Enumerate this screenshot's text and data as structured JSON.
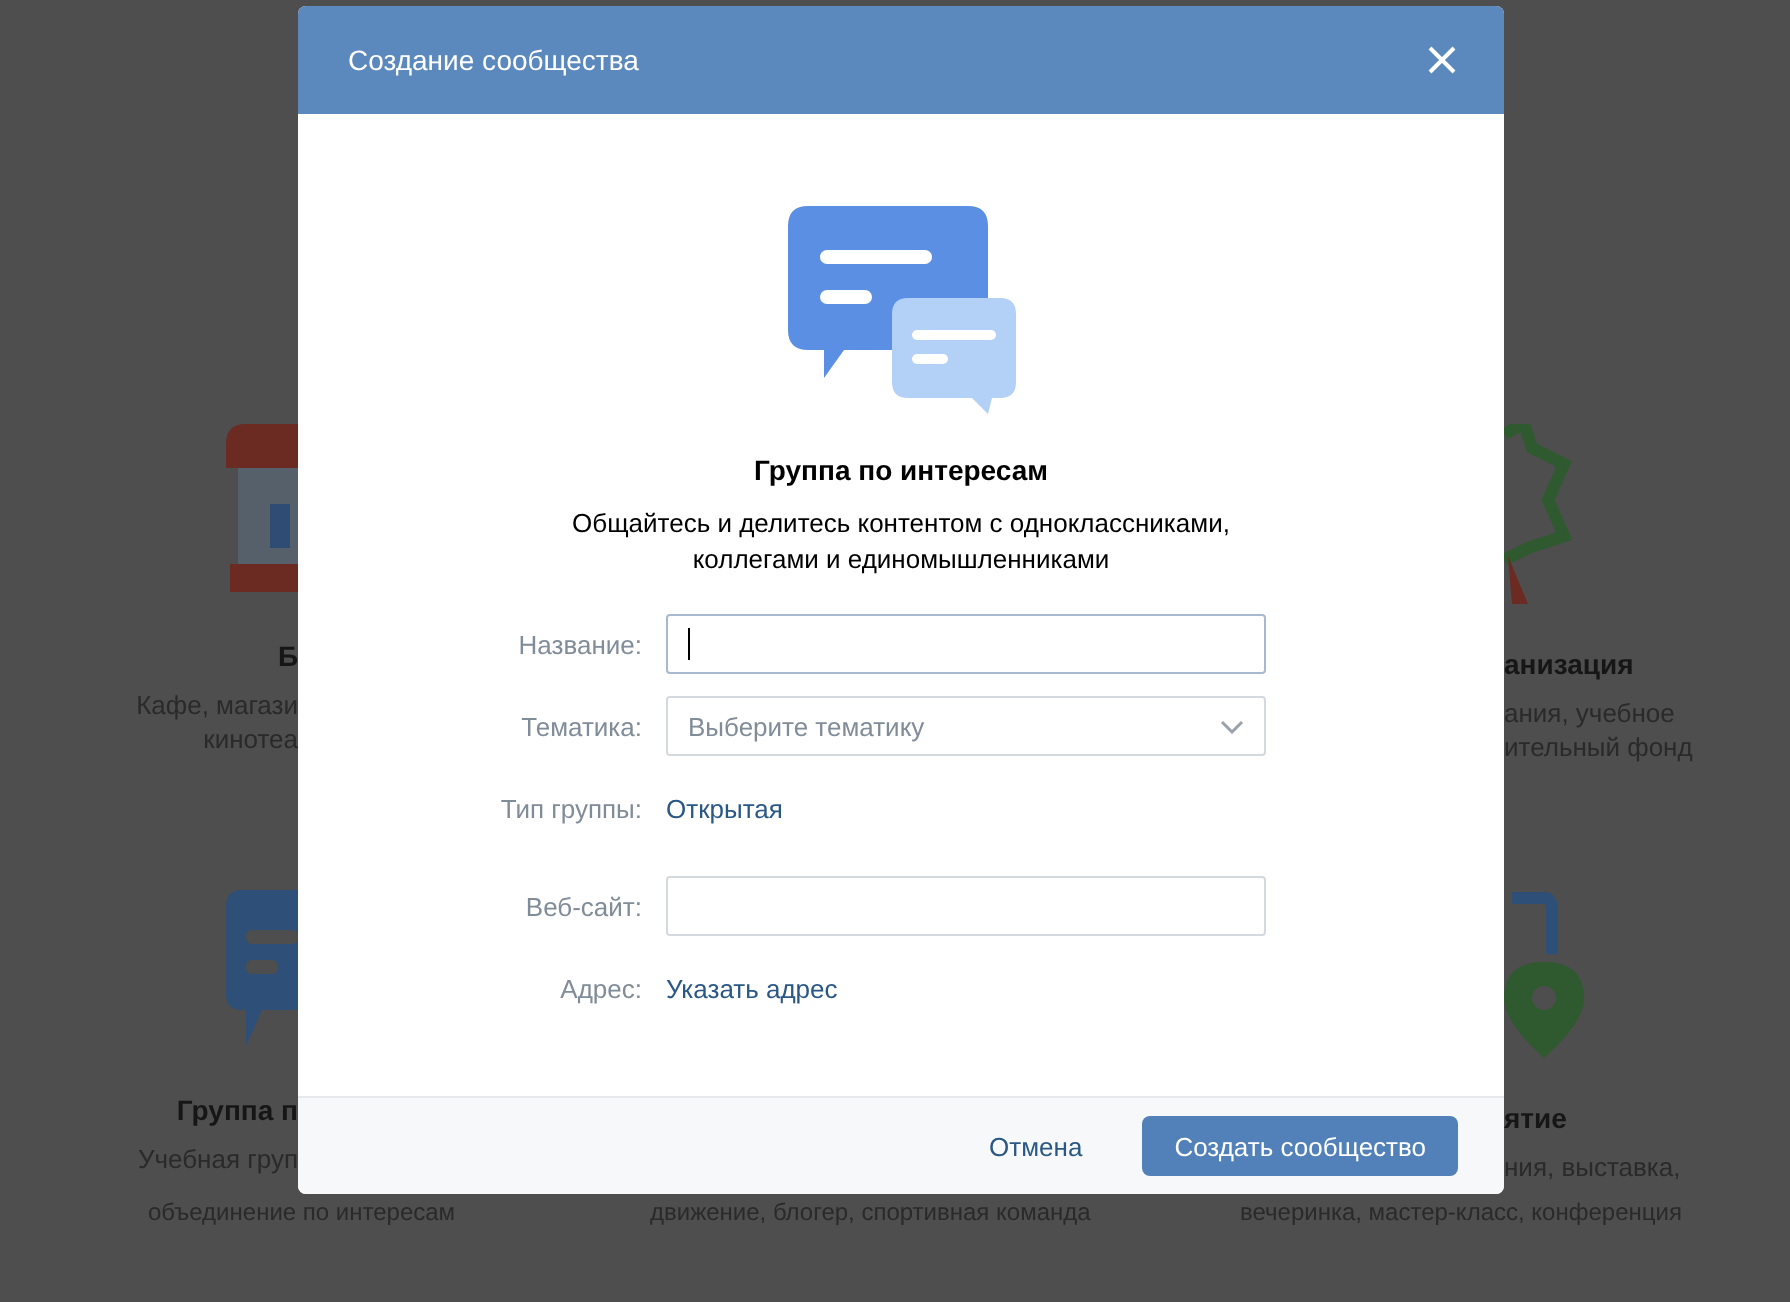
{
  "backdrop": {
    "left": [
      {
        "heading": "Б",
        "lines": [
          "Кафе, магази",
          "кинотеа"
        ]
      },
      {
        "heading": "Группа п",
        "lines": [
          "Учебная груп"
        ]
      }
    ],
    "right": [
      {
        "heading": "анизация",
        "lines": [
          "ания, учебное",
          "ительный фонд"
        ]
      },
      {
        "heading": "ятие",
        "lines": [
          "ния, выставка,"
        ]
      }
    ],
    "bottom": [
      "объединение по интересам",
      "движение, блогер, спортивная команда",
      "вечеринка, мастер-класс, конференция"
    ]
  },
  "modal": {
    "title": "Создание сообщества",
    "heading": "Группа по интересам",
    "description": "Общайтесь и делитесь контентом с одноклассниками, коллегами и единомышленниками",
    "fields": [
      {
        "kind": "text",
        "label": "Название:",
        "focused": true
      },
      {
        "kind": "select",
        "label": "Тематика:",
        "placeholder": "Выберите тематику"
      },
      {
        "kind": "link",
        "label": "Тип группы:",
        "value": "Открытая"
      },
      {
        "kind": "text",
        "label": "Веб-сайт:",
        "focused": false
      },
      {
        "kind": "link",
        "label": "Адрес:",
        "value": "Указать адрес"
      }
    ],
    "buttons": [
      {
        "kind": "secondary",
        "label": "Отмена"
      },
      {
        "kind": "primary",
        "label": "Создать сообщество"
      }
    ]
  }
}
